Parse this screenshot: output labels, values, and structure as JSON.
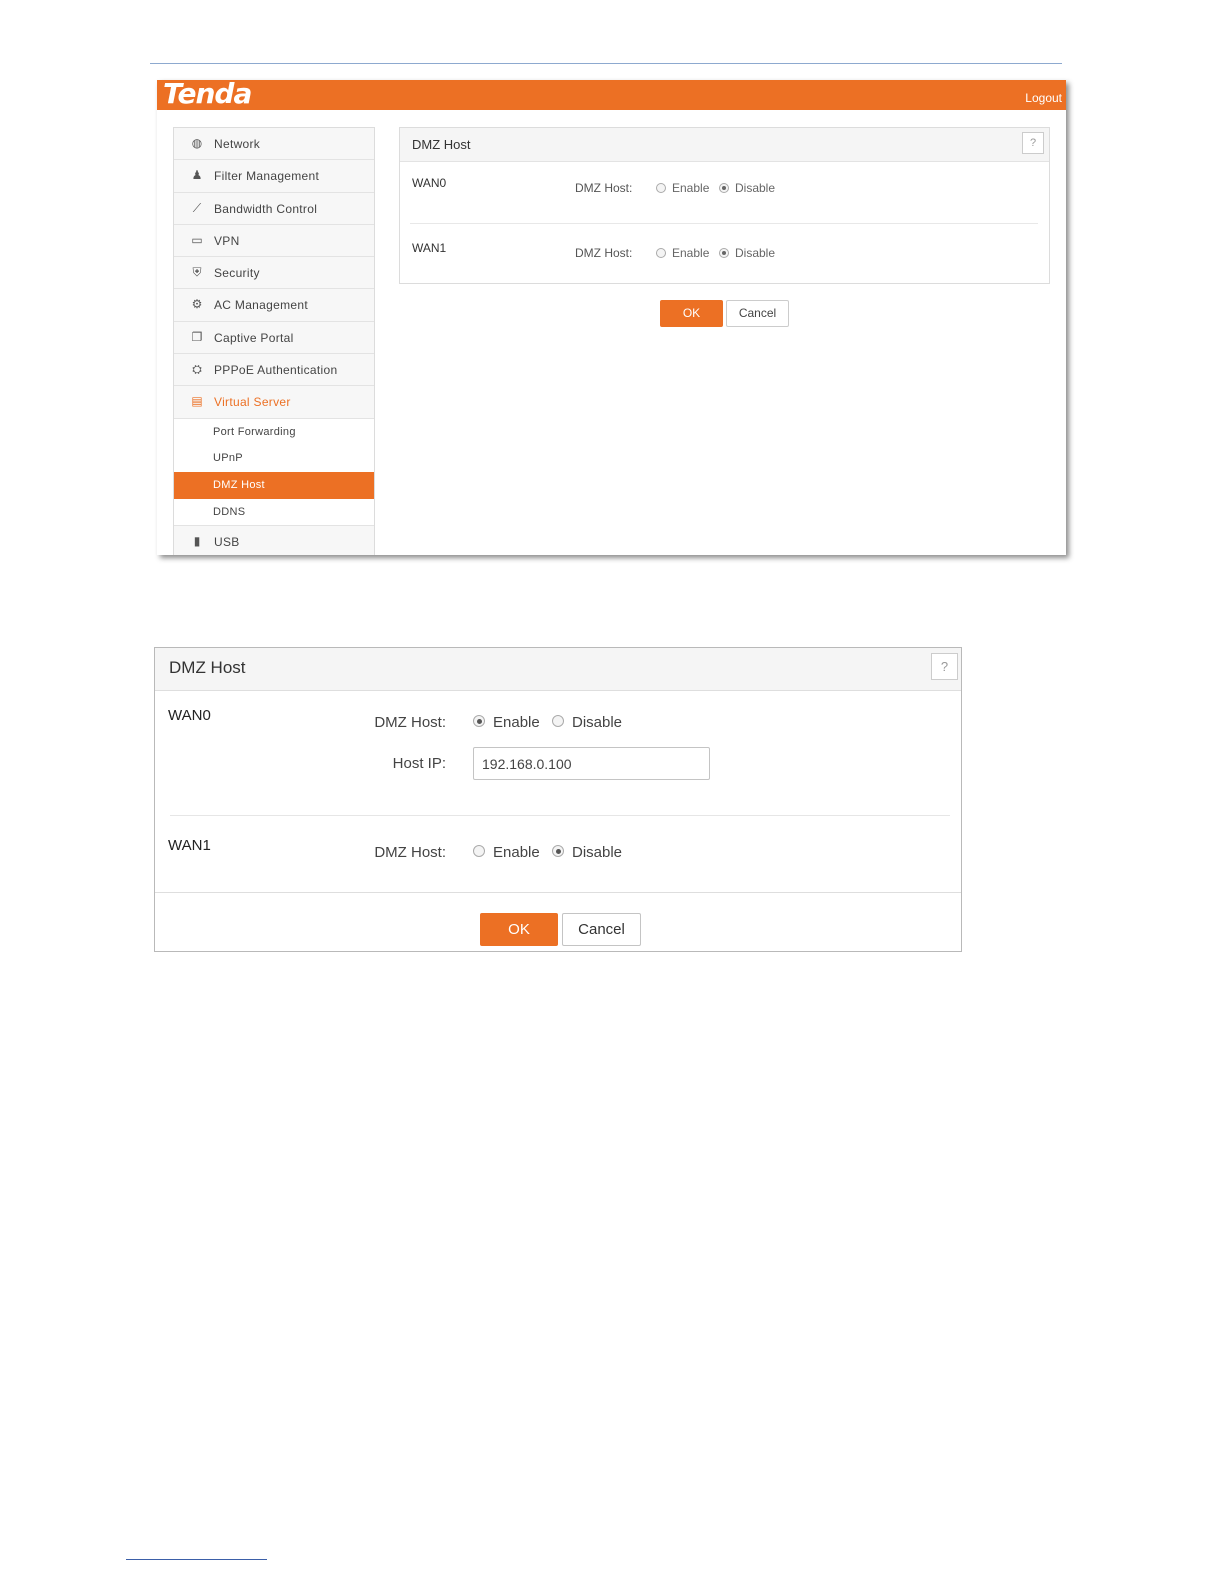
{
  "screenshot1": {
    "brand": "Tenda",
    "logout": "Logout",
    "nav": [
      {
        "label": "Network",
        "icon": "globe-icon",
        "glyph": "◍"
      },
      {
        "label": "Filter Management",
        "icon": "user-filter-icon",
        "glyph": "♟"
      },
      {
        "label": "Bandwidth Control",
        "icon": "chart-line-icon",
        "glyph": "⟋"
      },
      {
        "label": "VPN",
        "icon": "monitor-icon",
        "glyph": "▭"
      },
      {
        "label": "Security",
        "icon": "shield-icon",
        "glyph": "⛨"
      },
      {
        "label": "AC Management",
        "icon": "ac-management-icon",
        "glyph": "⚙"
      },
      {
        "label": "Captive Portal",
        "icon": "portal-icon",
        "glyph": "❐"
      },
      {
        "label": "PPPoE Authentication",
        "icon": "pppoe-icon",
        "glyph": "⛭"
      },
      {
        "label": "Virtual Server",
        "icon": "server-icon",
        "glyph": "▤"
      }
    ],
    "subnav": [
      "Port Forwarding",
      "UPnP",
      "DMZ Host",
      "DDNS"
    ],
    "nav_bottom": {
      "label": "USB",
      "icon": "usb-icon",
      "glyph": "▮"
    },
    "panel_title": "DMZ Host",
    "help": "?",
    "wan0": {
      "name": "WAN0",
      "label": "DMZ Host:",
      "enable": "Enable",
      "disable": "Disable",
      "selected": "Disable"
    },
    "wan1": {
      "name": "WAN1",
      "label": "DMZ Host:",
      "enable": "Enable",
      "disable": "Disable",
      "selected": "Disable"
    },
    "ok": "OK",
    "cancel": "Cancel"
  },
  "screenshot2": {
    "panel_title": "DMZ Host",
    "help": "?",
    "wan0": {
      "name": "WAN0",
      "label": "DMZ Host:",
      "enable": "Enable",
      "disable": "Disable",
      "selected": "Enable",
      "host_ip_label": "Host IP:",
      "host_ip_value": "192.168.0.100"
    },
    "wan1": {
      "name": "WAN1",
      "label": "DMZ Host:",
      "enable": "Enable",
      "disable": "Disable",
      "selected": "Disable"
    },
    "ok": "OK",
    "cancel": "Cancel"
  },
  "colors": {
    "accent": "#ec7024",
    "rule": "#8da9cf"
  }
}
